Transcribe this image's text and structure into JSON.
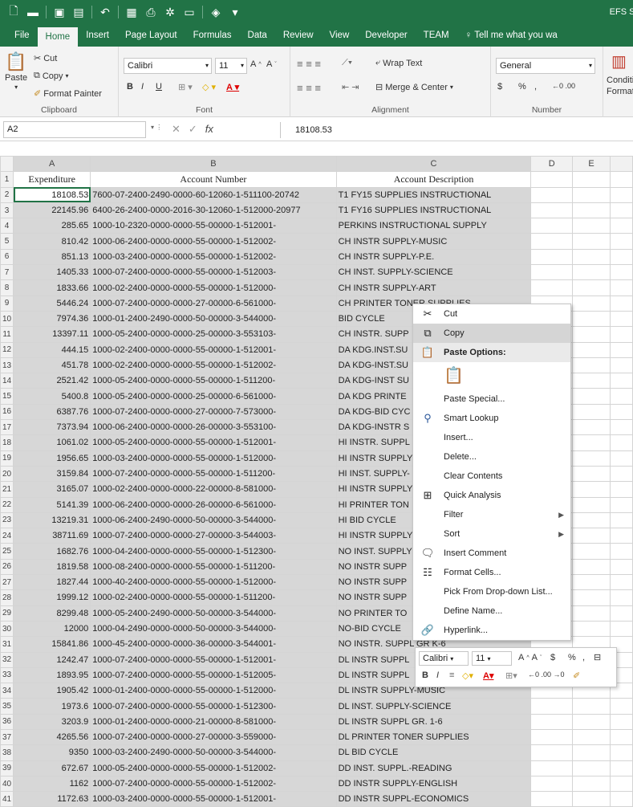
{
  "app": {
    "doc_title": "EFS Standa",
    "accent": "#217346"
  },
  "tabs": [
    "File",
    "Home",
    "Insert",
    "Page Layout",
    "Formulas",
    "Data",
    "Review",
    "View",
    "Developer",
    "TEAM",
    "♀ Tell me what you wa"
  ],
  "ribbon": {
    "clipboard": {
      "paste": "Paste",
      "cut": "Cut",
      "copy": "Copy",
      "format_painter": "Format Painter",
      "label": "Clipboard"
    },
    "font": {
      "name": "Calibri",
      "size": "11",
      "label": "Font",
      "bold": "B",
      "italic": "I",
      "underline": "U"
    },
    "alignment": {
      "wrap": "Wrap Text",
      "merge": "Merge & Center",
      "label": "Alignment"
    },
    "number": {
      "format": "General",
      "label": "Number",
      "currency": "$",
      "percent": "%",
      "comma": ","
    },
    "styles": {
      "cond": "Conditi",
      "format": "Format"
    }
  },
  "formula_bar": {
    "cell": "A2",
    "value": "18108.53"
  },
  "columns": [
    "A",
    "B",
    "C",
    "D",
    "E"
  ],
  "header_row": {
    "row": "1",
    "a": "Expenditure",
    "b": "Account Number",
    "c": "Account Description"
  },
  "rows": [
    {
      "n": "2",
      "a": "18108.53",
      "b": "7600-07-2400-2490-0000-60-12060-1-511100-20742",
      "c": "T1 FY15 SUPPLIES INSTRUCTIONAL"
    },
    {
      "n": "3",
      "a": "22145.96",
      "b": "6400-26-2400-0000-2016-30-12060-1-512000-20977",
      "c": "T1 FY16 SUPPLIES INSTRUCTIONAL"
    },
    {
      "n": "4",
      "a": "285.65",
      "b": "1000-10-2320-0000-0000-55-00000-1-512001-",
      "c": "PERKINS INSTRUCTIONAL SUPPLY"
    },
    {
      "n": "5",
      "a": "810.42",
      "b": "1000-06-2400-0000-0000-55-00000-1-512002-",
      "c": "CH INSTR SUPPLY-MUSIC"
    },
    {
      "n": "6",
      "a": "851.13",
      "b": "1000-03-2400-0000-0000-55-00000-1-512002-",
      "c": "CH INSTR SUPPLY-P.E."
    },
    {
      "n": "7",
      "a": "1405.33",
      "b": "1000-07-2400-0000-0000-55-00000-1-512003-",
      "c": "CH INST. SUPPLY-SCIENCE"
    },
    {
      "n": "8",
      "a": "1833.66",
      "b": "1000-02-2400-0000-0000-55-00000-1-512000-",
      "c": "CH INSTR SUPPLY-ART"
    },
    {
      "n": "9",
      "a": "5446.24",
      "b": "1000-07-2400-0000-0000-27-00000-6-561000-",
      "c": "CH PRINTER TONER SUPPLIES"
    },
    {
      "n": "10",
      "a": "7974.36",
      "b": "1000-01-2400-2490-0000-50-00000-3-544000-",
      "c": "BID CYCLE"
    },
    {
      "n": "11",
      "a": "13397.11",
      "b": "1000-05-2400-0000-0000-25-00000-3-553103-",
      "c": "CH INSTR. SUPP"
    },
    {
      "n": "12",
      "a": "444.15",
      "b": "1000-02-2400-0000-0000-55-00000-1-512001-",
      "c": "DA KDG.INST.SU"
    },
    {
      "n": "13",
      "a": "451.78",
      "b": "1000-02-2400-0000-0000-55-00000-1-512002-",
      "c": "DA KDG-INST.SU"
    },
    {
      "n": "14",
      "a": "2521.42",
      "b": "1000-05-2400-0000-0000-55-00000-1-511200-",
      "c": "DA KDG-INST SU"
    },
    {
      "n": "15",
      "a": "5400.8",
      "b": "1000-05-2400-0000-0000-25-00000-6-561000-",
      "c": "DA KDG PRINTE"
    },
    {
      "n": "16",
      "a": "6387.76",
      "b": "1000-07-2400-0000-0000-27-00000-7-573000-",
      "c": "DA KDG-BID CYC"
    },
    {
      "n": "17",
      "a": "7373.94",
      "b": "1000-06-2400-0000-0000-26-00000-3-553100-",
      "c": "DA KDG-INSTR S"
    },
    {
      "n": "18",
      "a": "1061.02",
      "b": "1000-05-2400-0000-0000-55-00000-1-512001-",
      "c": "HI INSTR. SUPPL"
    },
    {
      "n": "19",
      "a": "1956.65",
      "b": "1000-03-2400-0000-0000-55-00000-1-512000-",
      "c": "HI INSTR SUPPLY"
    },
    {
      "n": "20",
      "a": "3159.84",
      "b": "1000-07-2400-0000-0000-55-00000-1-511200-",
      "c": "HI INST. SUPPLY-"
    },
    {
      "n": "21",
      "a": "3165.07",
      "b": "1000-02-2400-0000-0000-22-00000-8-581000-",
      "c": "HI INSTR SUPPLY"
    },
    {
      "n": "22",
      "a": "5141.39",
      "b": "1000-06-2400-0000-0000-26-00000-6-561000-",
      "c": "HI PRINTER TON"
    },
    {
      "n": "23",
      "a": "13219.31",
      "b": "1000-06-2400-2490-0000-50-00000-3-544000-",
      "c": "HI BID CYCLE"
    },
    {
      "n": "24",
      "a": "38711.69",
      "b": "1000-07-2400-0000-0000-27-00000-3-544003-",
      "c": "HI INSTR SUPPLY"
    },
    {
      "n": "25",
      "a": "1682.76",
      "b": "1000-04-2400-0000-0000-55-00000-1-512300-",
      "c": "NO INST. SUPPLY"
    },
    {
      "n": "26",
      "a": "1819.58",
      "b": "1000-08-2400-0000-0000-55-00000-1-511200-",
      "c": "NO INSTR SUPP"
    },
    {
      "n": "27",
      "a": "1827.44",
      "b": "1000-40-2400-0000-0000-55-00000-1-512000-",
      "c": "NO INSTR SUPP"
    },
    {
      "n": "28",
      "a": "1999.12",
      "b": "1000-02-2400-0000-0000-55-00000-1-511200-",
      "c": "NO INSTR SUPP"
    },
    {
      "n": "29",
      "a": "8299.48",
      "b": "1000-05-2400-2490-0000-50-00000-3-544000-",
      "c": "NO PRINTER TO"
    },
    {
      "n": "30",
      "a": "12000",
      "b": "1000-04-2490-0000-0000-50-00000-3-544000-",
      "c": "NO-BID CYCLE"
    },
    {
      "n": "31",
      "a": "15841.86",
      "b": "1000-45-2400-0000-0000-36-00000-3-544001-",
      "c": "NO INSTR. SUPPL  GR K-6"
    },
    {
      "n": "32",
      "a": "1242.47",
      "b": "1000-07-2400-0000-0000-55-00000-1-512001-",
      "c": "DL INSTR SUPPL"
    },
    {
      "n": "33",
      "a": "1893.95",
      "b": "1000-07-2400-0000-0000-55-00000-1-512005-",
      "c": "DL INSTR SUPPL"
    },
    {
      "n": "34",
      "a": "1905.42",
      "b": "1000-01-2400-0000-0000-55-00000-1-512000-",
      "c": "DL INSTR SUPPLY-MUSIC"
    },
    {
      "n": "35",
      "a": "1973.6",
      "b": "1000-07-2400-0000-0000-55-00000-1-512300-",
      "c": "DL INST. SUPPLY-SCIENCE"
    },
    {
      "n": "36",
      "a": "3203.9",
      "b": "1000-01-2400-0000-0000-21-00000-8-581000-",
      "c": "DL INSTR SUPPL GR. 1-6"
    },
    {
      "n": "37",
      "a": "4265.56",
      "b": "1000-07-2400-0000-0000-27-00000-3-559000-",
      "c": "DL PRINTER TONER SUPPLIES"
    },
    {
      "n": "38",
      "a": "9350",
      "b": "1000-03-2400-2490-0000-50-00000-3-544000-",
      "c": "DL BID CYCLE"
    },
    {
      "n": "39",
      "a": "672.67",
      "b": "1000-05-2400-0000-0000-55-00000-1-512002-",
      "c": "DD INST. SUPPL.-READING"
    },
    {
      "n": "40",
      "a": "1162",
      "b": "1000-07-2400-0000-0000-55-00000-1-512002-",
      "c": "DD INSTR SUPPLY-ENGLISH"
    },
    {
      "n": "41",
      "a": "1172.63",
      "b": "1000-03-2400-0000-0000-55-00000-1-512001-",
      "c": "DD INSTR SUPPL-ECONOMICS"
    }
  ],
  "context_menu": {
    "cut": "Cut",
    "copy": "Copy",
    "paste_options": "Paste Options:",
    "paste_special": "Paste Special...",
    "smart_lookup": "Smart Lookup",
    "insert": "Insert...",
    "delete": "Delete...",
    "clear": "Clear Contents",
    "quick_analysis": "Quick Analysis",
    "filter": "Filter",
    "sort": "Sort",
    "insert_comment": "Insert Comment",
    "format_cells": "Format Cells...",
    "pick_list": "Pick From Drop-down List...",
    "define_name": "Define Name...",
    "hyperlink": "Hyperlink..."
  },
  "mini_toolbar": {
    "font": "Calibri",
    "size": "11",
    "currency": "$",
    "percent": "%",
    "comma": ","
  }
}
